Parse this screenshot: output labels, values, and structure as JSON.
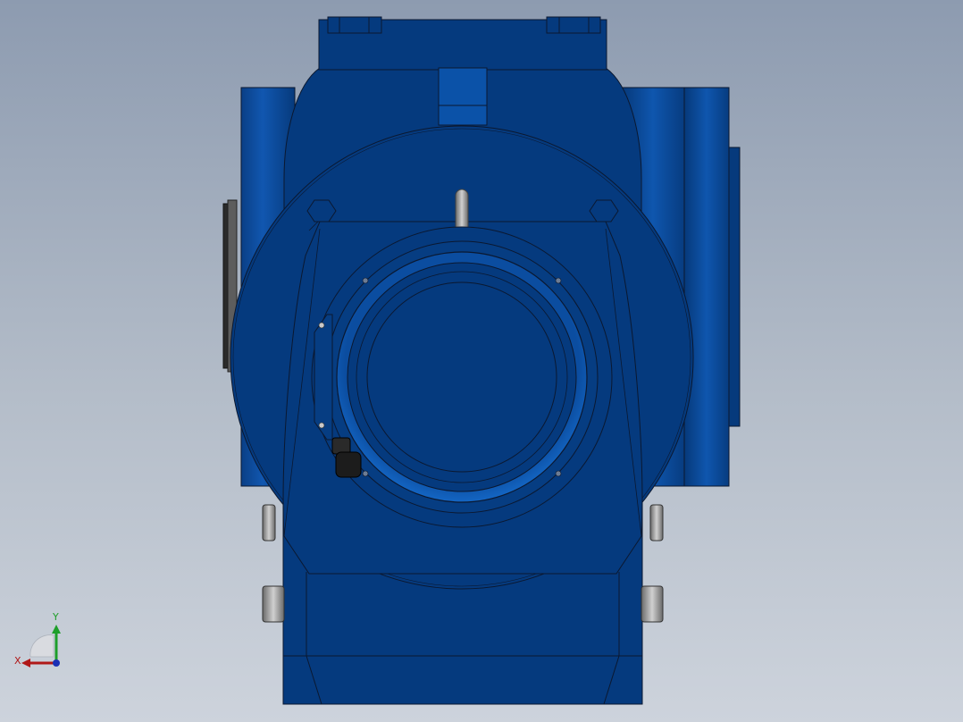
{
  "viewport": {
    "background_top": "#8d9bb0",
    "background_bottom": "#cdd3dc"
  },
  "model": {
    "body_color": "#053a7e",
    "body_highlight": "#0b52a8",
    "edge_color": "#0b1830",
    "fastener_color": "#9a9a9a",
    "cable_gland_color": "#1c1c1c"
  },
  "triad": {
    "x_label": "X",
    "y_label": "Y",
    "x_color": "#b01818",
    "y_color": "#1e9e2a",
    "z_color": "#1a2fb5"
  }
}
